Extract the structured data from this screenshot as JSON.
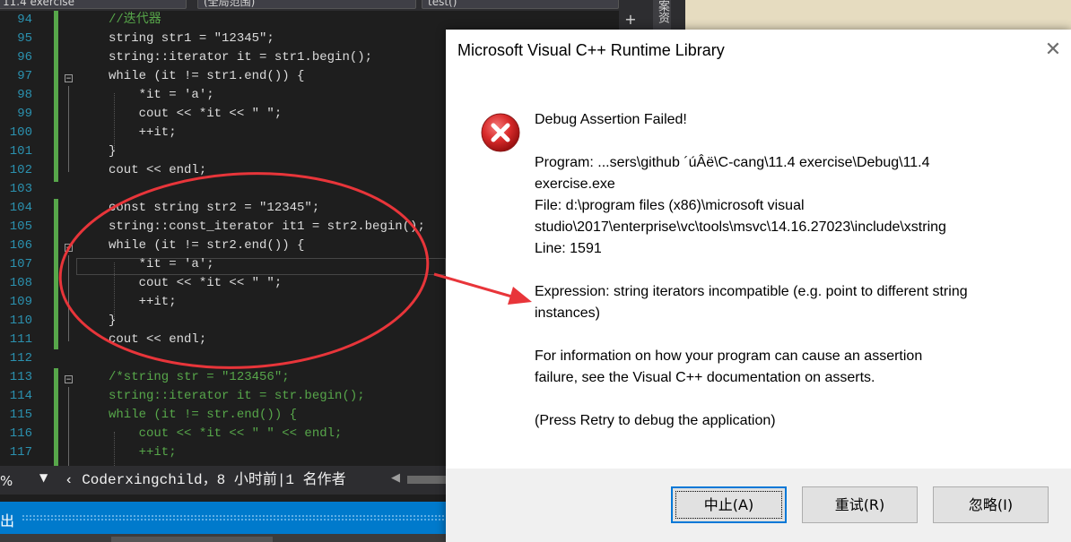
{
  "editor": {
    "tabs": {
      "file_partial": "11.4 exercise",
      "scope_partial": "(全局范围)",
      "function_partial": "test()"
    },
    "split_symbol": "+",
    "side_tab_label": "案资",
    "line_numbers": [
      "94",
      "95",
      "96",
      "97",
      "98",
      "99",
      "100",
      "101",
      "102",
      "103",
      "104",
      "105",
      "106",
      "107",
      "108",
      "109",
      "110",
      "111",
      "112",
      "113",
      "114",
      "115",
      "116",
      "117"
    ],
    "code_lines": [
      "//迭代器",
      "string str1 = \"12345\";",
      "string::iterator it = str1.begin();",
      "while (it != str1.end()) {",
      "    *it = 'a';",
      "    cout << *it << \" \";",
      "    ++it;",
      "}",
      "cout << endl;",
      "",
      "const string str2 = \"12345\";",
      "string::const_iterator it1 = str2.begin();",
      "while (it != str2.end()) {",
      "    *it = 'a';",
      "    cout << *it << \" \";",
      "    ++it;",
      "}",
      "cout << endl;",
      "",
      "/*string str = \"123456\";",
      "string::iterator it = str.begin();",
      "while (it != str.end()) {",
      "    cout << *it << \" \" << endl;",
      "    ++it;"
    ],
    "status": {
      "zoom": "%",
      "git_info": "Coderxingchild，8 小时前|1 名作者"
    },
    "output_label": "出"
  },
  "dialog": {
    "title": "Microsoft Visual C++ Runtime Library",
    "heading": "Debug Assertion Failed!",
    "program_line1": "Program: ...sers\\github ´úÂë\\C-cang\\11.4 exercise\\Debug\\11.4",
    "program_line2": "exercise.exe",
    "file_line1": "File: d:\\program files (x86)\\microsoft visual",
    "file_line2": "studio\\2017\\enterprise\\vc\\tools\\msvc\\14.16.27023\\include\\xstring",
    "line_text": "Line: 1591",
    "expression_line1": "Expression: string iterators incompatible (e.g. point to different string",
    "expression_line2": "instances)",
    "info_line1": "For information on how your program can cause an assertion",
    "info_line2": "failure, see the Visual C++ documentation on asserts.",
    "press_retry": "(Press Retry to debug the application)",
    "buttons": {
      "abort": "中止(A)",
      "retry": "重试(R)",
      "ignore": "忽略(I)"
    }
  },
  "colors": {
    "annotation": "#e8353a",
    "accent": "#007acc",
    "error_icon": "#d92b2b"
  }
}
